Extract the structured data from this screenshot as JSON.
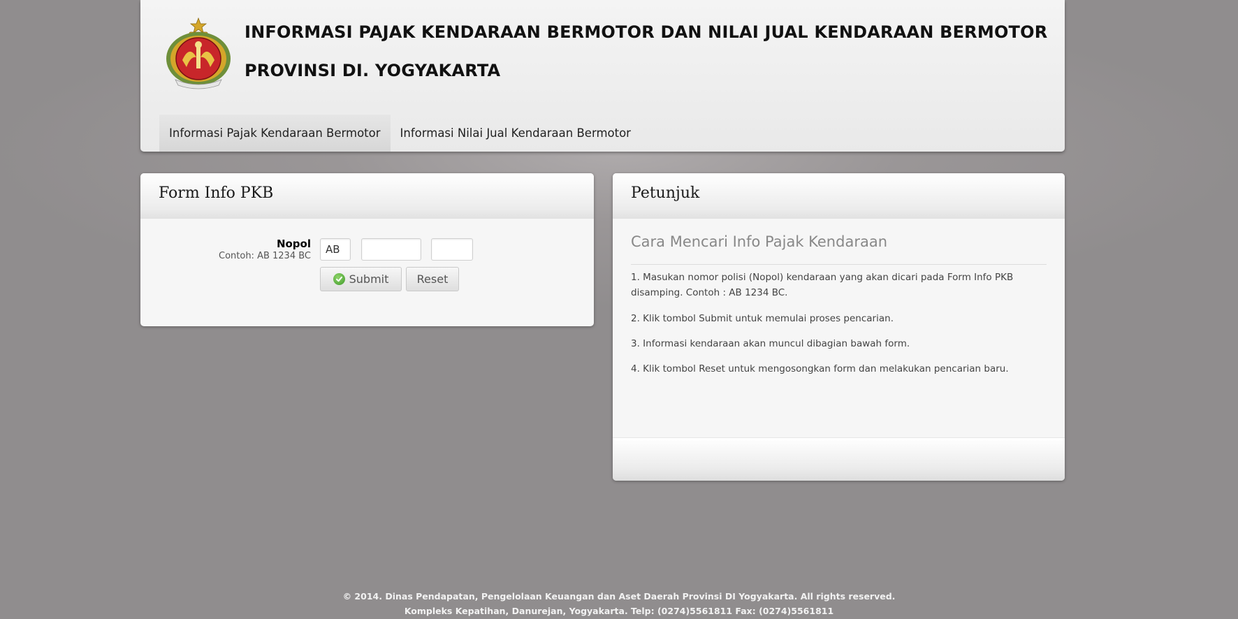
{
  "header": {
    "title_line1": "INFORMASI PAJAK KENDARAAN BERMOTOR DAN NILAI JUAL KENDARAAN BERMOTOR",
    "title_line2": "PROVINSI DI. YOGYAKARTA",
    "logo_icon": "province-crest-icon"
  },
  "nav": {
    "items": [
      {
        "label": "Informasi Pajak Kendaraan Bermotor",
        "active": true
      },
      {
        "label": "Informasi Nilai Jual Kendaraan Bermotor",
        "active": false
      }
    ]
  },
  "form_panel": {
    "title": "Form Info PKB",
    "nopol_label": "Nopol",
    "nopol_example": "Contoh: AB 1234 BC",
    "area_code_value": "AB",
    "number_value": "",
    "suffix_value": "",
    "submit_label": "Submit",
    "submit_icon": "check-circle-icon",
    "reset_label": "Reset"
  },
  "help_panel": {
    "title": "Petunjuk",
    "heading": "Cara Mencari Info Pajak Kendaraan",
    "steps": [
      "1. Masukan nomor polisi (Nopol) kendaraan yang akan dicari pada Form Info PKB disamping. Contoh : AB 1234 BC.",
      "2. Klik tombol Submit untuk memulai proses pencarian.",
      "3. Informasi kendaraan akan muncul dibagian bawah form.",
      "4. Klik tombol Reset untuk mengosongkan form dan melakukan pencarian baru."
    ]
  },
  "footer": {
    "line1": "© 2014. Dinas Pendapatan, Pengelolaan Keuangan dan Aset Daerah Provinsi DI Yogyakarta. All rights reserved.",
    "line2": "Kompleks Kepatihan, Danurejan, Yogyakarta. Telp: (0274)5561811 Fax: (0274)5561811"
  },
  "colors": {
    "page_background": "#908d8e",
    "panel_background": "#f6f6f6",
    "submit_icon_green": "#4caf2f",
    "crest_red": "#c8262a",
    "crest_gold": "#d4a62a"
  }
}
